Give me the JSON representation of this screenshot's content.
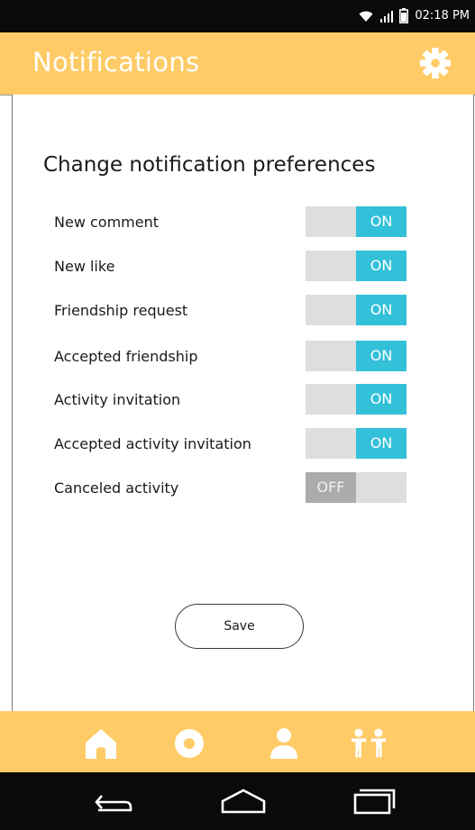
{
  "status_bar": {
    "time": "02:18 PM"
  },
  "app_bar": {
    "title": "Notifications",
    "settings_icon": "gear-icon"
  },
  "main": {
    "section_title": "Change notification preferences",
    "preferences": [
      {
        "label": "New comment",
        "state": "ON"
      },
      {
        "label": "New like",
        "state": "ON"
      },
      {
        "label": "Friendship request",
        "state": "ON"
      },
      {
        "label": "Accepted friendship",
        "state": "ON"
      },
      {
        "label": "Activity invitation",
        "state": "ON"
      },
      {
        "label": "Accepted activity invitation",
        "state": "ON"
      },
      {
        "label": "Canceled activity",
        "state": "OFF"
      }
    ],
    "save_label": "Save"
  },
  "bottom_nav": {
    "items": [
      "home-icon",
      "disc-icon",
      "person-icon",
      "group-icon"
    ]
  },
  "system_nav": {
    "items": [
      "back-icon",
      "home-outline-icon",
      "recents-icon"
    ]
  },
  "colors": {
    "accent": "#ffcb66",
    "toggle_on": "#33c0d9",
    "toggle_off": "#ababab",
    "toggle_track": "#dedede"
  }
}
